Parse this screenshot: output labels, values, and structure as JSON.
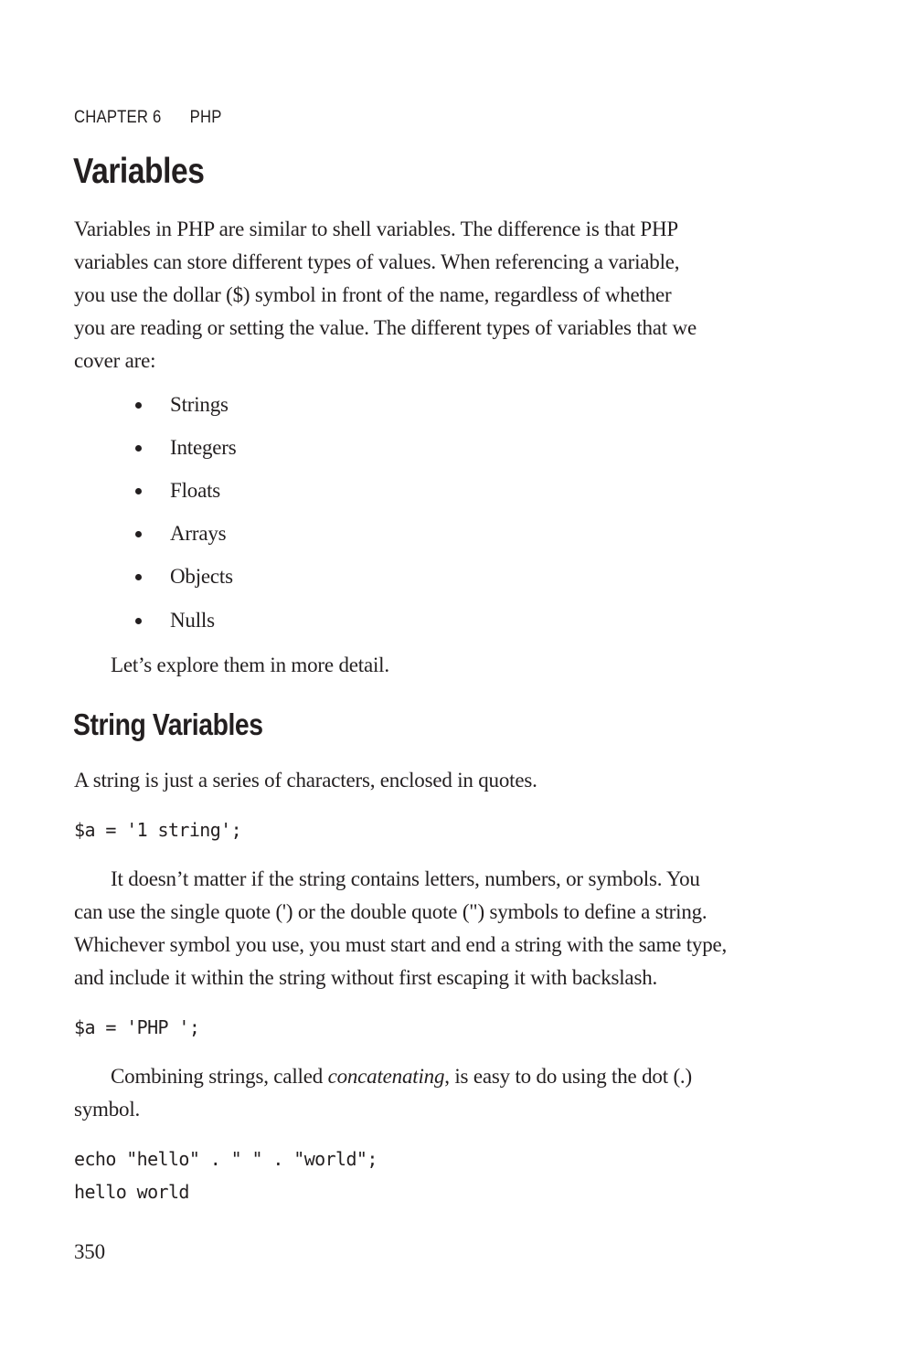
{
  "running_head": {
    "chapter": "CHAPTER 6",
    "title": "PHP"
  },
  "section": {
    "heading": "Variables",
    "intro_lines": [
      "Variables in PHP are similar to shell variables. The difference is that PHP",
      "variables can store different types of values. When referencing a variable,",
      "you use the dollar ($) symbol in front of the name, regardless of whether",
      "you are reading or setting the value. The different types of variables that we",
      "cover are:"
    ],
    "types_list": [
      "Strings",
      "Integers",
      "Floats",
      "Arrays",
      "Objects",
      "Nulls"
    ],
    "outro": "Let’s explore them in more detail."
  },
  "subsection": {
    "heading": "String Variables",
    "p1": "A string is just a series of characters, enclosed in quotes.",
    "code1": "$a = '1 string';",
    "p2_lines": [
      "It doesn’t matter if the string contains letters, numbers, or symbols. You",
      "can use the single quote (') or the double quote (\") symbols to define a string.",
      "Whichever symbol you use, you must start and end a string with the same type,",
      "and include it within the string without first escaping it with backslash."
    ],
    "code2": "$a = 'PHP ';",
    "p3": {
      "before": "Combining strings, called ",
      "emphasis": "concatenating",
      "after": ", is easy to do using the dot (.)",
      "line2": "symbol."
    },
    "code3_lines": [
      "echo \"hello\" . \" \" . \"world\";",
      "hello world"
    ]
  },
  "footer": {
    "page_number": "350"
  }
}
